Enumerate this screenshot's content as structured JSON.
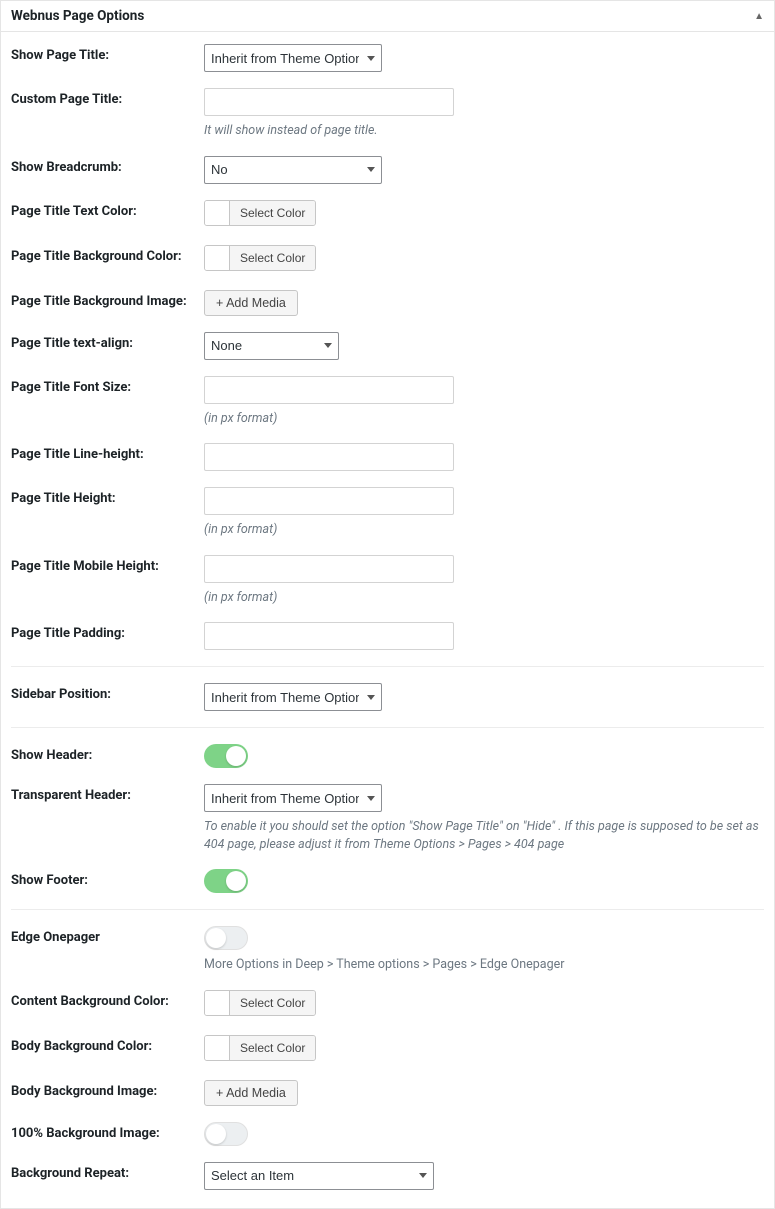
{
  "panel": {
    "title": "Webnus Page Options"
  },
  "common": {
    "select_color": "Select Color",
    "add_media": "+ Add Media",
    "px_format": "(in px format)",
    "inherit": "Inherit from Theme Options"
  },
  "fields": {
    "show_page_title": {
      "label": "Show Page Title:",
      "value": "Inherit from Theme Options"
    },
    "custom_page_title": {
      "label": "Custom Page Title:",
      "value": "",
      "hint": "It will show instead of page title."
    },
    "show_breadcrumb": {
      "label": "Show Breadcrumb:",
      "value": "No"
    },
    "title_text_color": {
      "label": "Page Title Text Color:"
    },
    "title_bg_color": {
      "label": "Page Title Background Color:"
    },
    "title_bg_image": {
      "label": "Page Title Background Image:"
    },
    "title_text_align": {
      "label": "Page Title text-align:",
      "value": "None"
    },
    "title_font_size": {
      "label": "Page Title Font Size:",
      "value": ""
    },
    "title_line_height": {
      "label": "Page Title Line-height:",
      "value": ""
    },
    "title_height": {
      "label": "Page Title Height:",
      "value": ""
    },
    "title_mobile_height": {
      "label": "Page Title Mobile Height:",
      "value": ""
    },
    "title_padding": {
      "label": "Page Title Padding:",
      "value": ""
    },
    "sidebar_position": {
      "label": "Sidebar Position:",
      "value": "Inherit from Theme Options"
    },
    "show_header": {
      "label": "Show Header:",
      "on": true
    },
    "transparent_header": {
      "label": "Transparent Header:",
      "value": "Inherit from Theme Options",
      "hint": "To enable it you should set the option \"Show Page Title\" on \"Hide\" . If this page is supposed to be set as 404 page, please adjust it from Theme Options > Pages > 404 page"
    },
    "show_footer": {
      "label": "Show Footer:",
      "on": true
    },
    "edge_onepager": {
      "label": "Edge Onepager",
      "on": false,
      "hint": "More Options in Deep > Theme options > Pages > Edge Onepager"
    },
    "content_bg_color": {
      "label": "Content Background Color:"
    },
    "body_bg_color": {
      "label": "Body Background Color:"
    },
    "body_bg_image": {
      "label": "Body Background Image:"
    },
    "bg_100": {
      "label": "100% Background Image:",
      "on": false
    },
    "bg_repeat": {
      "label": "Background Repeat:",
      "value": "Select an Item"
    }
  }
}
